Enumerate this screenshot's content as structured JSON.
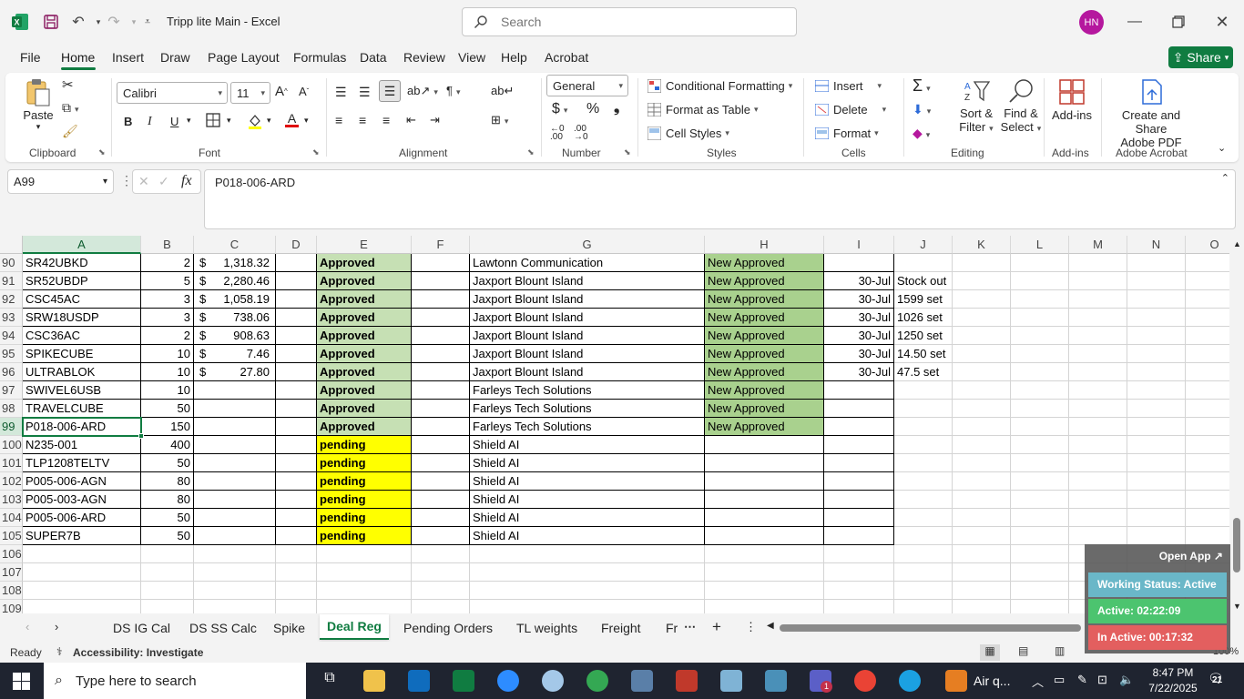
{
  "window": {
    "app_title": "Tripp lite Main  -  Excel",
    "search_placeholder": "Search",
    "avatar_initials": "HN"
  },
  "menu": {
    "tabs": [
      "File",
      "Home",
      "Insert",
      "Draw",
      "Page Layout",
      "Formulas",
      "Data",
      "Review",
      "View",
      "Help",
      "Acrobat"
    ],
    "active": "Home",
    "share_label": "Share"
  },
  "ribbon": {
    "clipboard": {
      "paste": "Paste",
      "label": "Clipboard"
    },
    "font": {
      "name": "Calibri",
      "size": "11",
      "label": "Font",
      "bold": "B",
      "italic": "I",
      "underline": "U"
    },
    "alignment": {
      "label": "Alignment"
    },
    "number": {
      "format": "General",
      "label": "Number",
      "currency": "$",
      "percent": "%"
    },
    "styles": {
      "conditional": "Conditional Formatting",
      "table": "Format as Table",
      "cell_styles": "Cell Styles",
      "label": "Styles"
    },
    "cells": {
      "insert": "Insert",
      "delete": "Delete",
      "format": "Format",
      "label": "Cells"
    },
    "editing": {
      "sort": "Sort &",
      "sort2": "Filter",
      "find": "Find &",
      "find2": "Select",
      "label": "Editing"
    },
    "addins": {
      "button": "Add-ins",
      "label": "Add-ins"
    },
    "acrobat": {
      "button1": "Create and Share",
      "button2": "Adobe PDF",
      "label": "Adobe Acrobat"
    }
  },
  "formula_bar": {
    "name_box": "A99",
    "fx": "fx",
    "value": "P018-006-ARD"
  },
  "columns": [
    "A",
    "B",
    "C",
    "D",
    "E",
    "F",
    "G",
    "H",
    "I",
    "J",
    "K",
    "L",
    "M",
    "N",
    "O"
  ],
  "rows": [
    {
      "n": "90",
      "a": "SR42UBKD",
      "b": "2",
      "c1": "$",
      "c2": "1,318.32",
      "e": "Approved",
      "g": "Lawtonn Communication",
      "h": "New Approved",
      "i": "",
      "j": ""
    },
    {
      "n": "91",
      "a": "SR52UBDP",
      "b": "5",
      "c1": "$",
      "c2": "2,280.46",
      "e": "Approved",
      "g": "Jaxport Blount Island",
      "h": "New Approved",
      "i": "30-Jul",
      "j": "Stock out"
    },
    {
      "n": "92",
      "a": "CSC45AC",
      "b": "3",
      "c1": "$",
      "c2": "1,058.19",
      "e": "Approved",
      "g": "Jaxport Blount Island",
      "h": "New Approved",
      "i": "30-Jul",
      "j": "1599 set"
    },
    {
      "n": "93",
      "a": "SRW18USDP",
      "b": "3",
      "c1": "$",
      "c2": "738.06",
      "e": "Approved",
      "g": "Jaxport Blount Island",
      "h": "New Approved",
      "i": "30-Jul",
      "j": "1026 set"
    },
    {
      "n": "94",
      "a": "CSC36AC",
      "b": "2",
      "c1": "$",
      "c2": "908.63",
      "e": "Approved",
      "g": "Jaxport Blount Island",
      "h": "New Approved",
      "i": "30-Jul",
      "j": "1250 set"
    },
    {
      "n": "95",
      "a": "SPIKECUBE",
      "b": "10",
      "c1": "$",
      "c2": "7.46",
      "e": "Approved",
      "g": "Jaxport Blount Island",
      "h": "New Approved",
      "i": "30-Jul",
      "j": "14.50 set"
    },
    {
      "n": "96",
      "a": "ULTRABLOK",
      "b": "10",
      "c1": "$",
      "c2": "27.80",
      "e": "Approved",
      "g": "Jaxport Blount Island",
      "h": "New Approved",
      "i": "30-Jul",
      "j": "47.5  set"
    },
    {
      "n": "97",
      "a": "SWIVEL6USB",
      "b": "10",
      "c1": "",
      "c2": "",
      "e": "Approved",
      "g": "Farleys Tech Solutions",
      "h": "New Approved",
      "i": "",
      "j": ""
    },
    {
      "n": "98",
      "a": "TRAVELCUBE",
      "b": "50",
      "c1": "",
      "c2": "",
      "e": "Approved",
      "g": "Farleys Tech Solutions",
      "h": "New Approved",
      "i": "",
      "j": ""
    },
    {
      "n": "99",
      "a": "P018-006-ARD",
      "b": "150",
      "c1": "",
      "c2": "",
      "e": "Approved",
      "g": "Farleys Tech Solutions",
      "h": "New Approved",
      "i": "",
      "j": ""
    },
    {
      "n": "100",
      "a": "N235-001",
      "b": "400",
      "c1": "",
      "c2": "",
      "e": "pending",
      "g": "Shield AI",
      "h": "",
      "i": "",
      "j": ""
    },
    {
      "n": "101",
      "a": "TLP1208TELTV",
      "b": "50",
      "c1": "",
      "c2": "",
      "e": "pending",
      "g": "Shield AI",
      "h": "",
      "i": "",
      "j": ""
    },
    {
      "n": "102",
      "a": "P005-006-AGN",
      "b": "80",
      "c1": "",
      "c2": "",
      "e": "pending",
      "g": "Shield AI",
      "h": "",
      "i": "",
      "j": ""
    },
    {
      "n": "103",
      "a": "P005-003-AGN",
      "b": "80",
      "c1": "",
      "c2": "",
      "e": "pending",
      "g": "Shield AI",
      "h": "",
      "i": "",
      "j": ""
    },
    {
      "n": "104",
      "a": "P005-006-ARD",
      "b": "50",
      "c1": "",
      "c2": "",
      "e": "pending",
      "g": "Shield AI",
      "h": "",
      "i": "",
      "j": ""
    },
    {
      "n": "105",
      "a": "SUPER7B",
      "b": "50",
      "c1": "",
      "c2": "",
      "e": "pending",
      "g": "Shield AI",
      "h": "",
      "i": "",
      "j": ""
    },
    {
      "n": "106",
      "a": "",
      "b": "",
      "c1": "",
      "c2": "",
      "e": "",
      "g": "",
      "h": "",
      "i": "",
      "j": ""
    },
    {
      "n": "107",
      "a": "",
      "b": "",
      "c1": "",
      "c2": "",
      "e": "",
      "g": "",
      "h": "",
      "i": "",
      "j": ""
    },
    {
      "n": "108",
      "a": "",
      "b": "",
      "c1": "",
      "c2": "",
      "e": "",
      "g": "",
      "h": "",
      "i": "",
      "j": ""
    },
    {
      "n": "109",
      "a": "",
      "b": "",
      "c1": "",
      "c2": "",
      "e": "",
      "g": "",
      "h": "",
      "i": "",
      "j": ""
    }
  ],
  "selected_row": "99",
  "sheets": {
    "tabs": [
      "DS IG Cal",
      "DS SS Calc",
      "Spike",
      "Deal Reg",
      "Pending Orders",
      "TL weights",
      "Freight",
      "Fr"
    ],
    "active": "Deal Reg"
  },
  "status": {
    "ready": "Ready",
    "accessibility": "Accessibility: Investigate",
    "zoom": "100%"
  },
  "widget": {
    "open_app": "Open App ↗",
    "working": "Working Status: Active",
    "active": "Active: 02:22:09",
    "inactive": "In Active: 00:17:32"
  },
  "taskbar": {
    "search_placeholder": "Type here to search",
    "weather": "Air q...",
    "time": "8:47 PM",
    "date": "7/22/2025",
    "notifications": "21",
    "teams_badge": "1"
  },
  "colors": {
    "excel_green": "#107c41",
    "approved_light": "#c6e0b4",
    "approved_dark": "#a9d18e",
    "pending_yellow": "#ffff00"
  }
}
